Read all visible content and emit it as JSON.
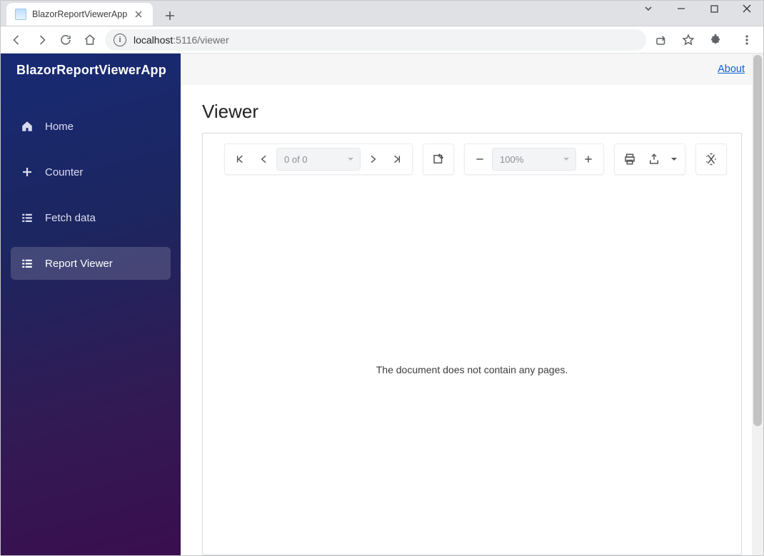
{
  "browser": {
    "tab_title": "BlazorReportViewerApp",
    "url_host": "localhost",
    "url_port": ":5116",
    "url_path": "/viewer"
  },
  "app": {
    "brand": "BlazorReportViewerApp",
    "about_label": "About",
    "nav": [
      {
        "label": "Home",
        "icon": "home"
      },
      {
        "label": "Counter",
        "icon": "plus"
      },
      {
        "label": "Fetch data",
        "icon": "list"
      },
      {
        "label": "Report Viewer",
        "icon": "list"
      }
    ],
    "active_nav_index": 3
  },
  "page": {
    "title": "Viewer"
  },
  "viewer": {
    "page_selector_text": "0 of 0",
    "zoom_text": "100%",
    "empty_message": "The document does not contain any pages."
  }
}
